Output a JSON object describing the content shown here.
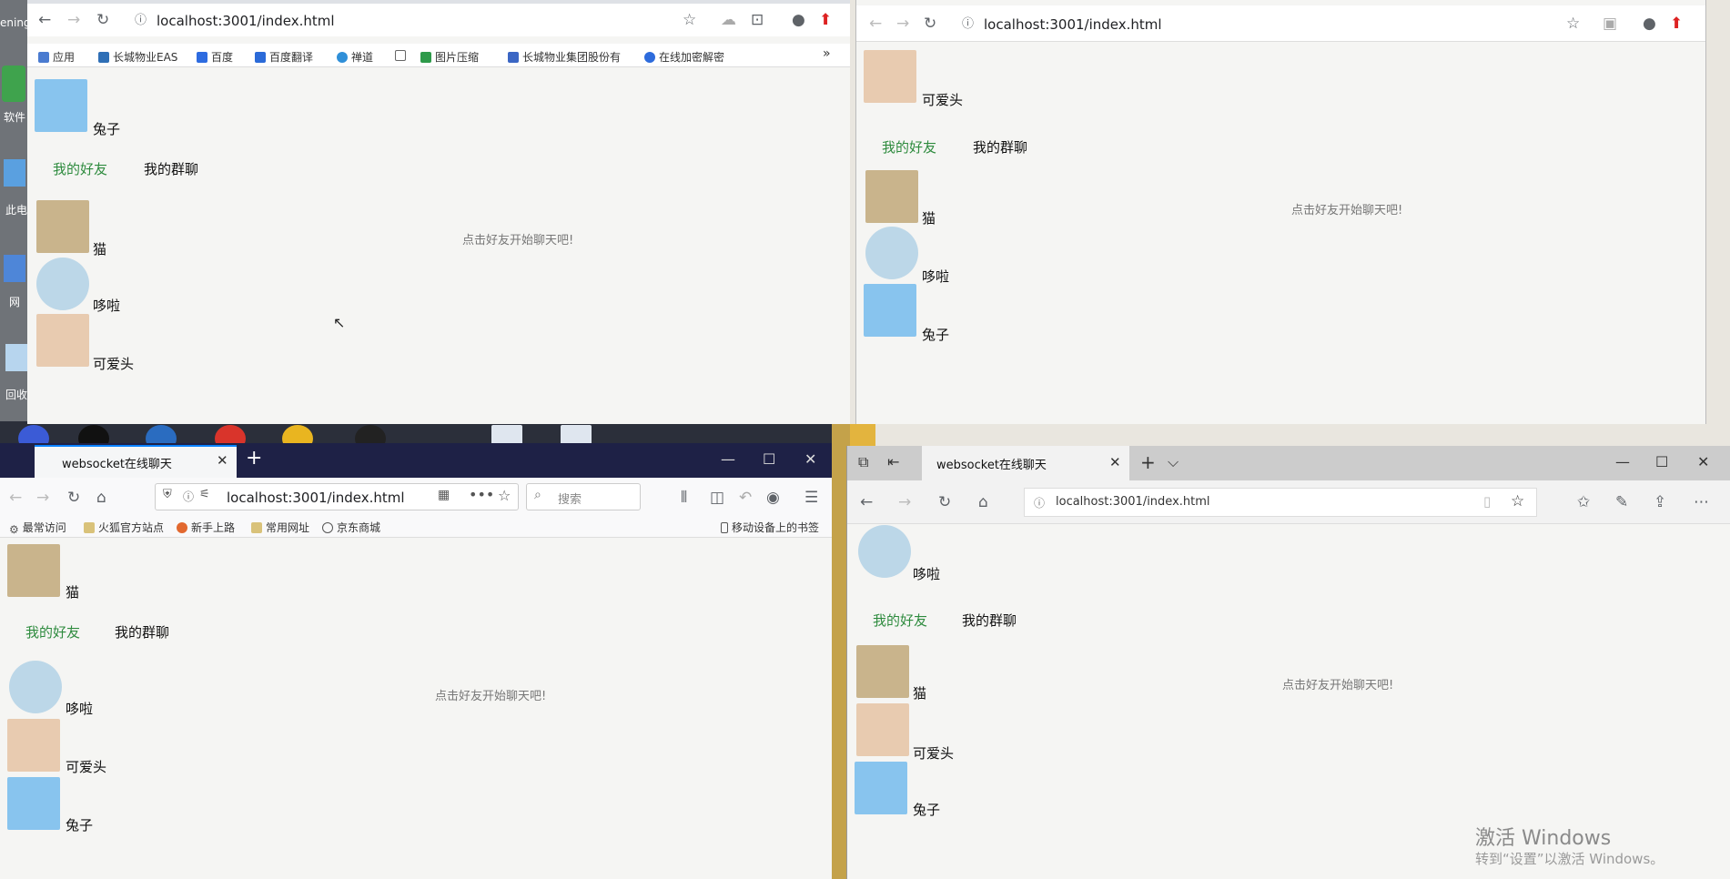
{
  "desktop": {
    "icon_labels": [
      "ening",
      "软件",
      "此电",
      "网",
      "回收"
    ],
    "watermark": {
      "line1": "激活 Windows",
      "line2": "转到“设置”以激活 Windows。"
    }
  },
  "chrome_left": {
    "url": "localhost:3001/index.html",
    "bookmarks": [
      "应用",
      "长城物业EAS",
      "百度",
      "百度翻译",
      "禅道",
      "图片压缩",
      "长城物业集团股份有",
      "在线加密解密"
    ],
    "overflow": "»",
    "page": {
      "current_user": "兔子",
      "tabs": [
        "我的好友",
        "我的群聊"
      ],
      "friends": [
        "猫",
        "哆啦",
        "可爱头"
      ],
      "hint": "点击好友开始聊天吧!"
    }
  },
  "chrome_right": {
    "url": "localhost:3001/index.html",
    "page": {
      "current_user": "可爱头",
      "tabs": [
        "我的好友",
        "我的群聊"
      ],
      "friends": [
        "猫",
        "哆啦",
        "兔子"
      ],
      "hint": "点击好友开始聊天吧!"
    }
  },
  "firefox": {
    "tab_title": "websocket在线聊天",
    "new_tab": "+",
    "url": "localhost:3001/index.html",
    "search_placeholder": "搜索",
    "bookmarks": [
      "最常访问",
      "火狐官方站点",
      "新手上路",
      "常用网址",
      "京东商城"
    ],
    "mobile_bookmarks": "移动设备上的书签",
    "page": {
      "current_user": "猫",
      "tabs": [
        "我的好友",
        "我的群聊"
      ],
      "friends": [
        "哆啦",
        "可爱头",
        "兔子"
      ],
      "hint": "点击好友开始聊天吧!"
    }
  },
  "edge": {
    "tab_title": "websocket在线聊天",
    "url": "localhost:3001/index.html",
    "page": {
      "current_user": "哆啦",
      "tabs": [
        "我的好友",
        "我的群聊"
      ],
      "friends": [
        "猫",
        "可爱头",
        "兔子"
      ],
      "hint": "点击好友开始聊天吧!"
    }
  },
  "colors": {
    "active_tab": "#2e8b3e",
    "page_bg": "#f5f5f3",
    "firefox_titlebar": "#1e2146",
    "edge_titlebar": "#cccccc"
  }
}
